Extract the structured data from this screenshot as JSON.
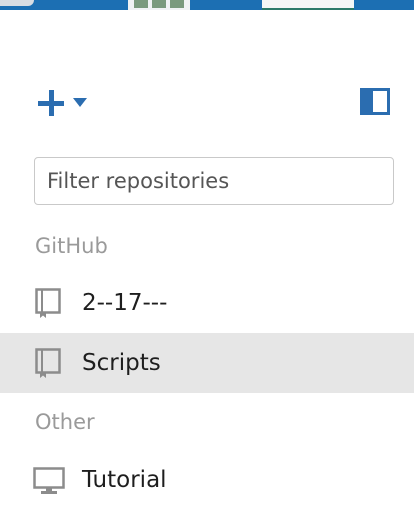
{
  "colors": {
    "accent": "#2b6db0",
    "selected_row_bg": "#e6e6e6",
    "section_header": "#9a9a9a",
    "icon_gray": "#8c8c8c"
  },
  "toolbar": {
    "add_icon": "plus-icon",
    "add_menu_icon": "caret-down-icon",
    "toggle_icon": "panel-toggle-icon"
  },
  "filter": {
    "placeholder": "Filter repositories",
    "value": ""
  },
  "sections": [
    {
      "header": "GitHub",
      "items": [
        {
          "label": "2--17---",
          "icon": "repo-book-icon",
          "selected": false
        },
        {
          "label": "Scripts",
          "icon": "repo-book-icon",
          "selected": true
        }
      ]
    },
    {
      "header": "Other",
      "items": [
        {
          "label": "Tutorial",
          "icon": "computer-monitor-icon",
          "selected": false
        }
      ]
    }
  ]
}
